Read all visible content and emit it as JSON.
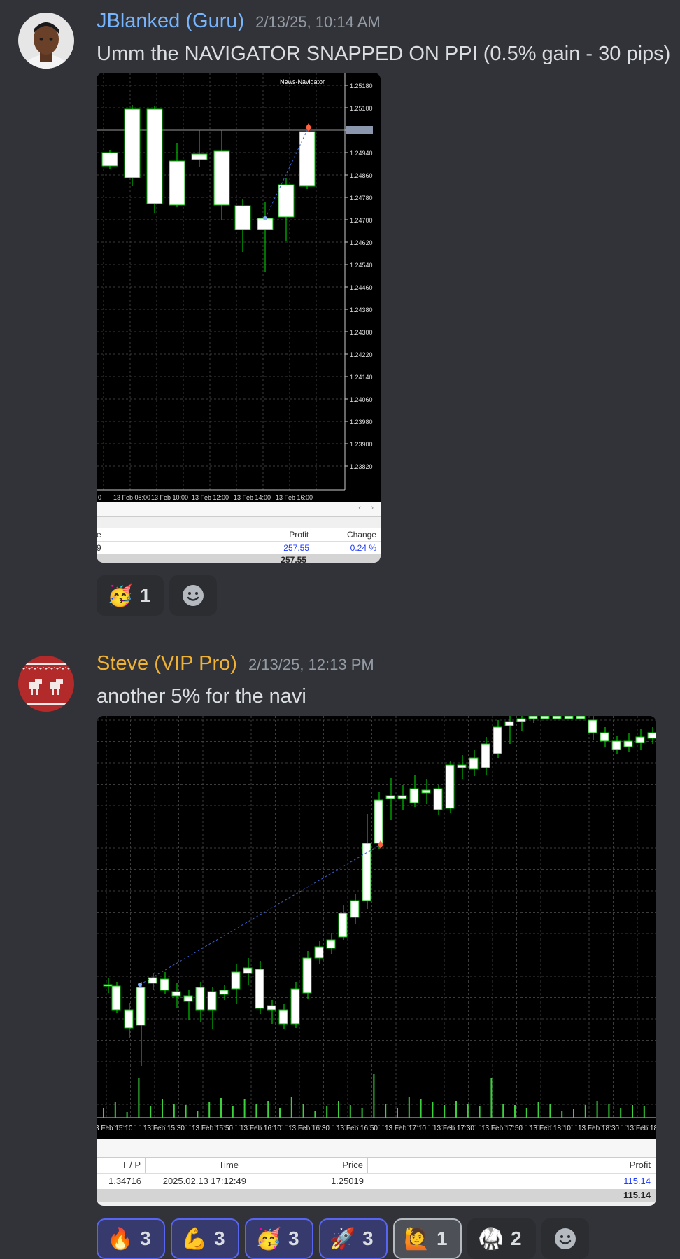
{
  "messages": [
    {
      "author": "JBlanked (Guru)",
      "author_color": "#77b5fe",
      "timestamp": "2/13/25, 10:14 AM",
      "text": "Umm the NAVIGATOR SNAPPED ON PPI (0.5% gain - 30 pips)",
      "chart": {
        "indicator_label": "News-Navigator",
        "price_ticks": [
          "1.25180",
          "1.25100",
          "1.25011",
          "1.24940",
          "1.24860",
          "1.24780",
          "1.24700",
          "1.24620",
          "1.24540",
          "1.24460",
          "1.24380",
          "1.24300",
          "1.24220",
          "1.24140",
          "1.24060",
          "1.23980",
          "1.23900",
          "1.23820"
        ],
        "time_ticks": [
          "0",
          "13 Feb 08:00",
          "13 Feb 10:00",
          "13 Feb 12:00",
          "13 Feb 14:00",
          "13 Feb 16:00"
        ],
        "table": {
          "headers": [
            "e",
            "Profit",
            "Change"
          ],
          "row": [
            "9",
            "257.55",
            "0.24 %"
          ],
          "total": "257.55"
        }
      },
      "reactions": [
        {
          "emoji": "🥳",
          "count": "1"
        }
      ]
    },
    {
      "author": "Steve (VIP Pro)",
      "author_color": "#f0b232",
      "timestamp": "2/13/25, 12:13 PM",
      "text": "another 5% for the navi",
      "chart": {
        "time_ticks": [
          "3 Feb 15:10",
          "13 Feb 15:30",
          "13 Feb 15:50",
          "13 Feb 16:10",
          "13 Feb 16:30",
          "13 Feb 16:50",
          "13 Feb 17:10",
          "13 Feb 17:30",
          "13 Feb 17:50",
          "13 Feb 18:10",
          "13 Feb 18:30",
          "13 Feb 18"
        ],
        "table": {
          "headers": [
            "T / P",
            "Time",
            "Price",
            "Profit"
          ],
          "row": [
            "1.34716",
            "2025.02.13 17:12:49",
            "1.25019",
            "115.14"
          ],
          "total": "115.14"
        }
      },
      "reactions": [
        {
          "emoji": "🔥",
          "count": "3"
        },
        {
          "emoji": "💪",
          "count": "3"
        },
        {
          "emoji": "🥳",
          "count": "3"
        },
        {
          "emoji": "🚀",
          "count": "3"
        },
        {
          "emoji": "🙋",
          "count": "1"
        },
        {
          "emoji": "🥋",
          "count": "2"
        }
      ]
    }
  ],
  "colors": {
    "background": "#313338",
    "candle_bull": "#ffffff",
    "candle_wick": "#00c000",
    "grid": "#3a3a3a",
    "profit_blue": "#1d3bff"
  }
}
